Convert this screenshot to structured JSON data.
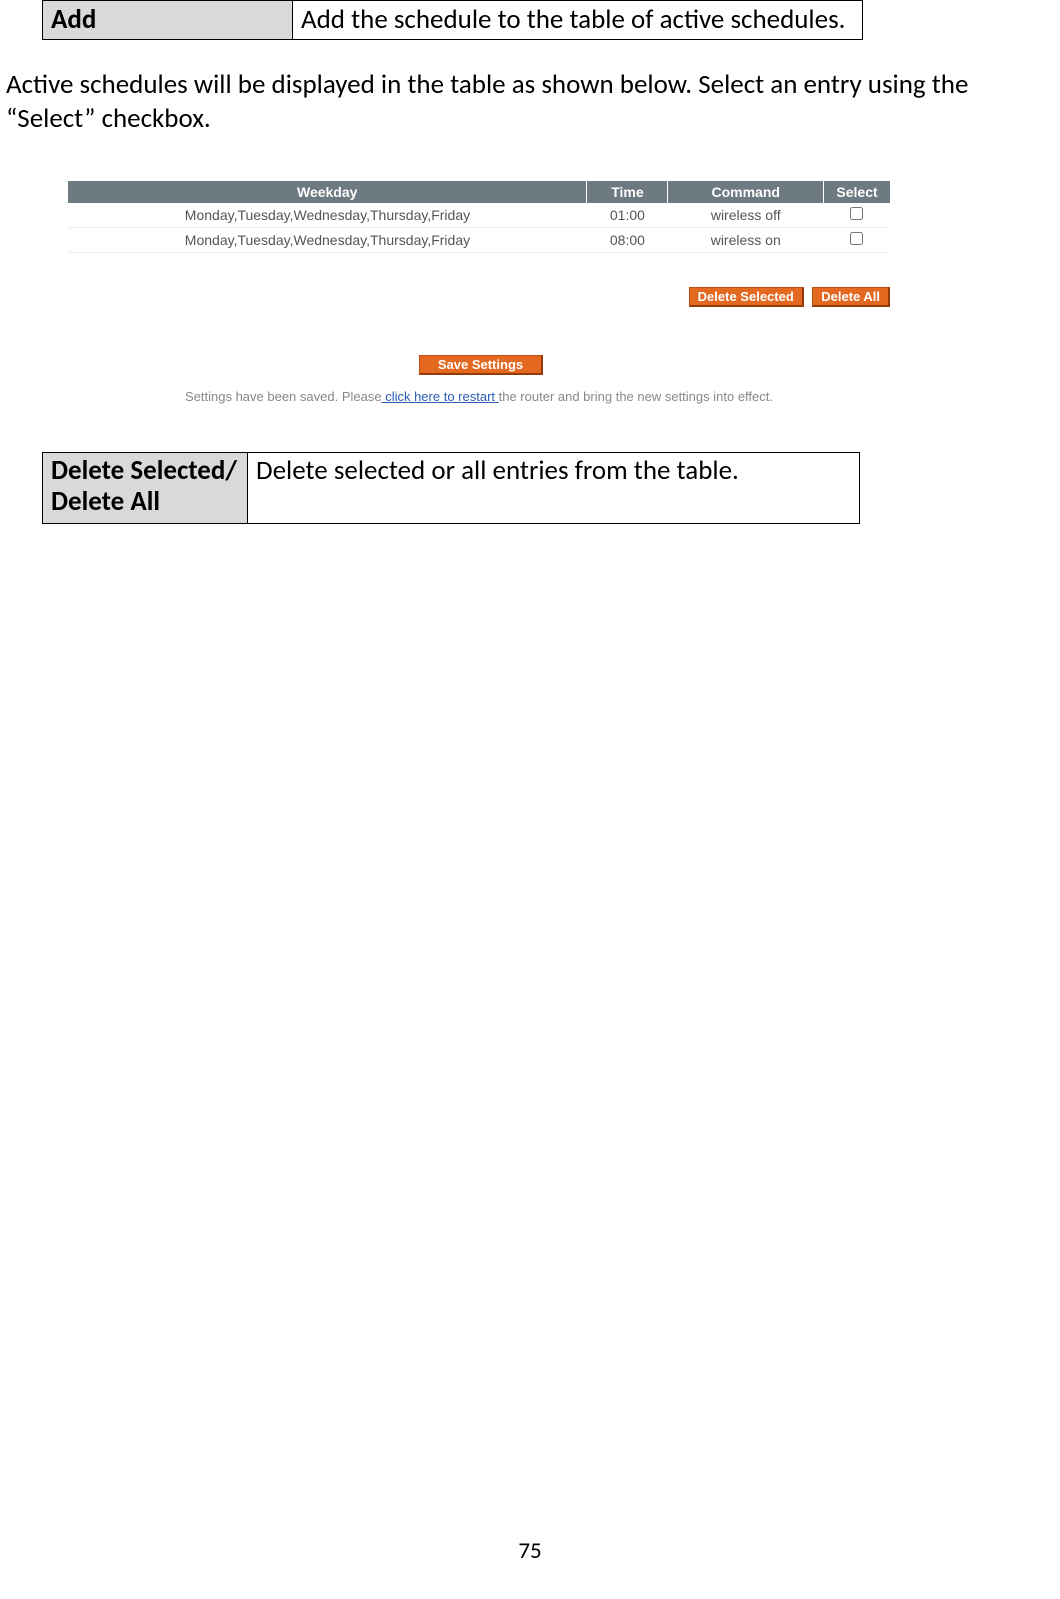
{
  "addTable": {
    "term": "Add",
    "desc": "Add the schedule to the table of active schedules."
  },
  "bodyText": "Active schedules will be displayed in the table as shown below. Select an entry using the “Select” checkbox.",
  "schedule": {
    "headers": {
      "weekday": "Weekday",
      "time": "Time",
      "command": "Command",
      "select": "Select"
    },
    "rows": [
      {
        "weekday": "Monday,Tuesday,Wednesday,Thursday,Friday",
        "time": "01:00",
        "command": "wireless off"
      },
      {
        "weekday": "Monday,Tuesday,Wednesday,Thursday,Friday",
        "time": "08:00",
        "command": "wireless on"
      }
    ],
    "buttons": {
      "deleteSelected": "Delete Selected",
      "deleteAll": "Delete All",
      "save": "Save Settings"
    },
    "restart": {
      "pre": "Settings have been saved. Please",
      "link": " click here to restart ",
      "post": "the router and bring the new settings into effect."
    }
  },
  "deleteTable": {
    "term": "Delete Selected/ Delete All",
    "desc": "Delete selected or all entries from the table."
  },
  "pageNumber": "75"
}
